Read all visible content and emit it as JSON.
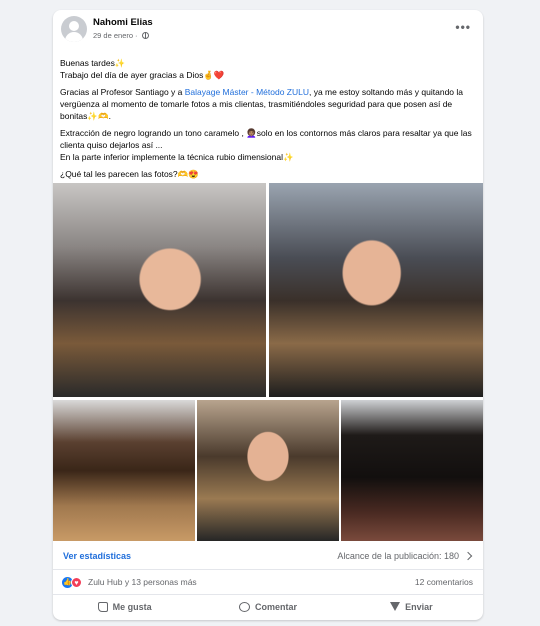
{
  "post": {
    "author": "Nahomi Elias",
    "date": "29 de enero",
    "date_sep": "·",
    "more": "•••",
    "paragraphs": [
      {
        "lines": [
          "Buenas tardes✨",
          "Trabajo del día de ayer gracias a Dios🤞❤️"
        ]
      },
      {
        "pre": "Gracias al Profesor Santiago y a ",
        "link": "Balayage Máster - Método ZULU",
        "post": ", ya me estoy soltando más y quitando la vergüenza al momento de tomarle fotos a mis clientas, trasmitiéndoles seguridad para que posen así de bonitas✨🫶."
      },
      {
        "lines": [
          "Extracción de negro logrando un tono caramelo , 👩🏽‍🦱solo en los contornos más claros para resaltar ya que las clienta quiso dejarlos así ...",
          "En la parte inferior implemente la técnica rubio dimensional✨"
        ]
      },
      {
        "lines": [
          "¿Qué tal les parecen las fotos?🫶😍"
        ]
      }
    ]
  },
  "photos": [
    {
      "name": "photo-front-1",
      "alt": "Clienta con balayage caramelo, vista frontal"
    },
    {
      "name": "photo-front-2",
      "alt": "Clienta con rubio dimensional, vista frontal"
    },
    {
      "name": "photo-back-1",
      "alt": "Vista posterior del cabello terminado"
    },
    {
      "name": "photo-front-3",
      "alt": "Clienta sonriendo con ondas"
    },
    {
      "name": "photo-back-2",
      "alt": "Cabello antes de la extracción"
    }
  ],
  "stats": {
    "link": "Ver estadísticas",
    "reach_label": "Alcance de la publicación: 180"
  },
  "reactions": {
    "text": "Zulu Hub y 13 personas más",
    "comments": "12 comentarios"
  },
  "actions": {
    "like": "Me gusta",
    "comment": "Comentar",
    "send": "Enviar"
  },
  "colors": {
    "link": "#216fdb",
    "like": "#1877f2",
    "love": "#f33e58",
    "muted": "#65676b"
  }
}
